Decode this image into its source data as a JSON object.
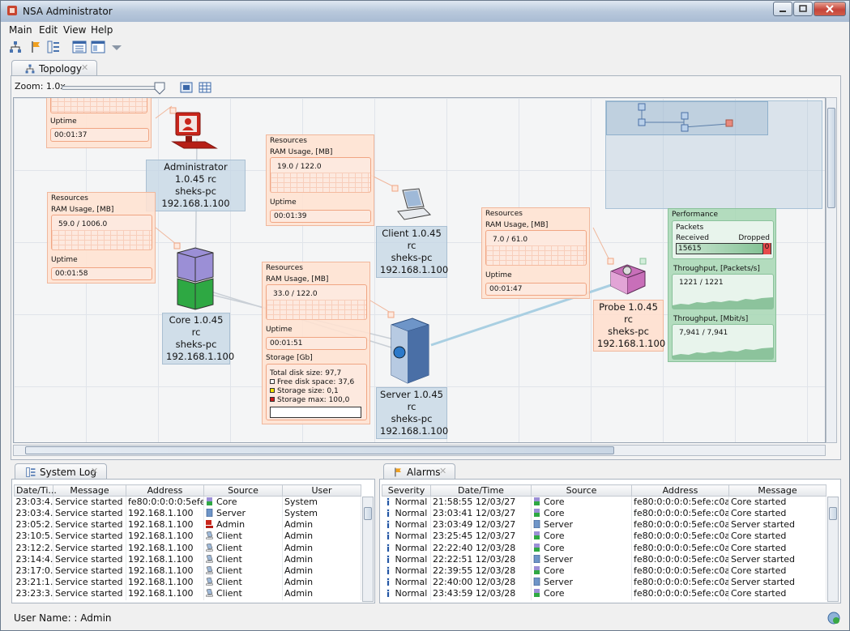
{
  "window": {
    "title": "NSA Administrator"
  },
  "menu": {
    "main": "Main",
    "edit": "Edit",
    "view": "View",
    "help": "Help"
  },
  "toolbar_icons": [
    "topology-icon",
    "alarm-flag-icon",
    "system-log-icon",
    "list-view-icon",
    "window-icon",
    "dropdown-icon"
  ],
  "topology": {
    "tab_label": "Topology",
    "zoom_label": "Zoom: 1.0x",
    "zoom_value": 1.0,
    "nodes": {
      "administrator": {
        "line1": "Administrator  1.0.45 rc",
        "line2": "sheks-pc",
        "line3": "192.168.1.100"
      },
      "client": {
        "line1": "Client  1.0.45 rc",
        "line2": "sheks-pc",
        "line3": "192.168.1.100"
      },
      "core": {
        "line1": "Core  1.0.45 rc",
        "line2": "sheks-pc",
        "line3": "192.168.1.100"
      },
      "server": {
        "line1": "Server  1.0.45 rc",
        "line2": "sheks-pc",
        "line3": "192.168.1.100"
      },
      "probe": {
        "line1": "Probe  1.0.45 rc",
        "line2": "sheks-pc",
        "line3": "192.168.1.100"
      }
    },
    "cards": {
      "top_left": {
        "uptime_label": "Uptime",
        "uptime": "00:01:37"
      },
      "client": {
        "resources": "Resources",
        "ram_label": "RAM Usage, [MB]",
        "ram": "19.0 / 122.0",
        "uptime_label": "Uptime",
        "uptime": "00:01:39"
      },
      "core": {
        "resources": "Resources",
        "ram_label": "RAM Usage, [MB]",
        "ram": "59.0 / 1006.0",
        "uptime_label": "Uptime",
        "uptime": "00:01:58"
      },
      "server": {
        "resources": "Resources",
        "ram_label": "RAM Usage, [MB]",
        "ram": "33.0 / 122.0",
        "uptime_label": "Uptime",
        "uptime": "00:01:51",
        "storage_label": "Storage [Gb]",
        "total": "Total disk size: 97,7",
        "free": "Free disk space: 37,6",
        "size": "Storage size: 0,1",
        "max": "Storage max: 100,0",
        "free_color": "#ffffff",
        "size_color": "#f5e400",
        "max_color": "#d11a1a"
      },
      "probe": {
        "resources": "Resources",
        "ram_label": "RAM Usage, [MB]",
        "ram": "7.0 / 61.0",
        "uptime_label": "Uptime",
        "uptime": "00:01:47"
      }
    },
    "performance": {
      "title": "Performance",
      "packets_label": "Packets",
      "received_label": "Received",
      "dropped_label": "Dropped",
      "received": "15615",
      "dropped": "0",
      "throughput_packets_label": "Throughput, [Packets/s]",
      "throughput_packets": "1221 / 1221",
      "throughput_mbits_label": "Throughput, [Mbit/s]",
      "throughput_mbits": "7,941 / 7,941"
    }
  },
  "system_log": {
    "tab_label": "System Log",
    "columns": [
      "Date/Ti...",
      "Message",
      "Address",
      "Source",
      "User"
    ],
    "rows": [
      [
        "23:03:4...",
        "Service started",
        "fe80:0:0:0:0:5efe:...",
        "Core",
        "System"
      ],
      [
        "23:03:4...",
        "Service started",
        "192.168.1.100",
        "Server",
        "System"
      ],
      [
        "23:05:2...",
        "Service started",
        "192.168.1.100",
        "Admin",
        "Admin"
      ],
      [
        "23:10:5...",
        "Service started",
        "192.168.1.100",
        "Client",
        "Admin"
      ],
      [
        "23:12:2...",
        "Service started",
        "192.168.1.100",
        "Client",
        "Admin"
      ],
      [
        "23:14:4...",
        "Service started",
        "192.168.1.100",
        "Client",
        "Admin"
      ],
      [
        "23:17:0...",
        "Service started",
        "192.168.1.100",
        "Client",
        "Admin"
      ],
      [
        "23:21:1...",
        "Service started",
        "192.168.1.100",
        "Client",
        "Admin"
      ],
      [
        "23:23:3...",
        "Service started",
        "192.168.1.100",
        "Client",
        "Admin"
      ]
    ]
  },
  "alarms": {
    "tab_label": "Alarms",
    "columns": [
      "Severity",
      "Date/Time",
      "Source",
      "Address",
      "Message"
    ],
    "rows": [
      [
        "Normal",
        "21:58:55 12/03/27",
        "Core",
        "fe80:0:0:0:0:5efe:c0a8...",
        "Core started"
      ],
      [
        "Normal",
        "23:03:41 12/03/27",
        "Core",
        "fe80:0:0:0:0:5efe:c0a8...",
        "Core started"
      ],
      [
        "Normal",
        "23:03:49 12/03/27",
        "Server",
        "fe80:0:0:0:0:5efe:c0a8...",
        "Server started"
      ],
      [
        "Normal",
        "23:25:45 12/03/27",
        "Core",
        "fe80:0:0:0:0:5efe:c0a8...",
        "Core started"
      ],
      [
        "Normal",
        "22:22:40 12/03/28",
        "Core",
        "fe80:0:0:0:0:5efe:c0a8...",
        "Core started"
      ],
      [
        "Normal",
        "22:22:51 12/03/28",
        "Server",
        "fe80:0:0:0:0:5efe:c0a8...",
        "Server started"
      ],
      [
        "Normal",
        "22:39:55 12/03/28",
        "Core",
        "fe80:0:0:0:0:5efe:c0a8...",
        "Core started"
      ],
      [
        "Normal",
        "22:40:00 12/03/28",
        "Server",
        "fe80:0:0:0:0:5efe:c0a8...",
        "Server started"
      ],
      [
        "Normal",
        "23:43:59 12/03/28",
        "Core",
        "fe80:0:0:0:0:5efe:c0a8...",
        "Core started"
      ]
    ]
  },
  "status": {
    "user_name": "User Name: : Admin"
  }
}
